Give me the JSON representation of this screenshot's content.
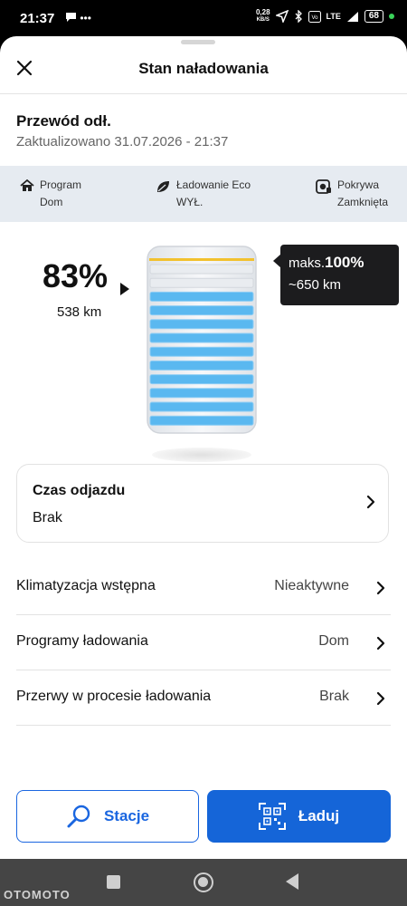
{
  "status_bar": {
    "time": "21:37",
    "net_speed_value": "0,28",
    "net_speed_unit": "KB/S",
    "signal_text": "LTE",
    "battery_level": "68",
    "icons": [
      "chat-bubble-icon",
      "dots-icon",
      "location-arrow-icon",
      "bluetooth-icon",
      "volte-icon",
      "signal-icon"
    ]
  },
  "header": {
    "title": "Stan naładowania",
    "close_icon": "close-icon"
  },
  "connection": {
    "title": "Przewód odł.",
    "updated": "Zaktualizowano 31.07.2026 - 21:37"
  },
  "info_bar": [
    {
      "icon": "home-plug-icon",
      "label": "Program",
      "value": "Dom"
    },
    {
      "icon": "leaf-icon",
      "label": "Ładowanie Eco",
      "value": "WYŁ."
    },
    {
      "icon": "charge-flap-icon",
      "label": "Pokrywa",
      "value": "Zamknięta"
    }
  ],
  "charge": {
    "percent_text": "83%",
    "level": 0.83,
    "range_text": "538 km",
    "max_label": "maks.",
    "max_percent": "100%",
    "max_range": "~650 km",
    "limit_color": "#f2c12e",
    "cell_color": "#5ab8f0"
  },
  "departure_card": {
    "title": "Czas odjazdu",
    "value": "Brak"
  },
  "settings_rows": [
    {
      "label": "Klimatyzacja wstępna",
      "value": "Nieaktywne"
    },
    {
      "label": "Programy ładowania",
      "value": "Dom"
    },
    {
      "label": "Przerwy w procesie ładowania",
      "value": "Brak"
    }
  ],
  "actions": {
    "stations_label": "Stacje",
    "charge_label": "Ładuj",
    "accent_color": "#1565d8"
  },
  "watermark": "OTOMOTO"
}
